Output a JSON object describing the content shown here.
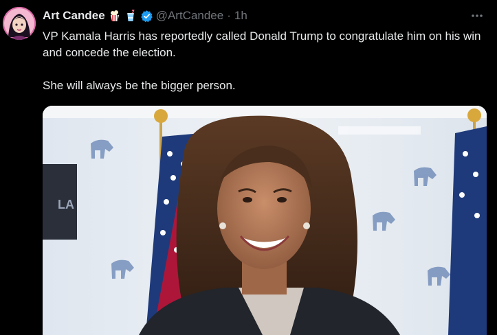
{
  "tweet": {
    "author": {
      "display_name": "Art Candee",
      "handle": "@ArtCandee",
      "verified": true,
      "badges": [
        "popcorn-emoji",
        "cup-with-straw-emoji",
        "verified-badge-icon"
      ]
    },
    "separator": "·",
    "time": "1h",
    "body": {
      "line_1": "VP Kamala Harris has reportedly called Donald Trump to congratulate him on his win and concede the election.",
      "line_2": "She will always be the bigger person."
    },
    "media": {
      "icon": "photo",
      "sign_text": "LA"
    },
    "more_icon": "more-horizontal-icon"
  },
  "colors": {
    "background": "#000000",
    "text_primary": "#e7e9ea",
    "text_secondary": "#71767b",
    "verified_blue": "#1d9bf0"
  }
}
